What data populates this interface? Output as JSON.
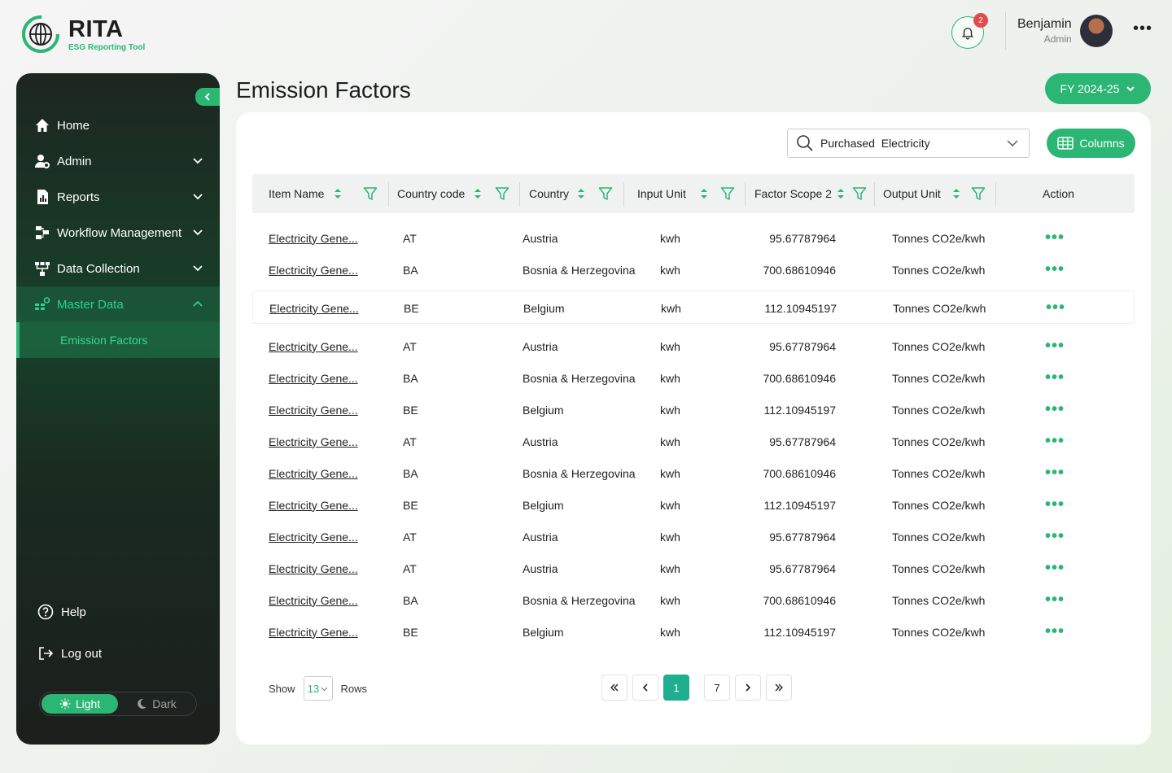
{
  "brand": {
    "title": "RITA",
    "subtitle": "ESG Reporting Tool"
  },
  "header": {
    "notifications": "2",
    "user_name": "Benjamin",
    "user_role": "Admin"
  },
  "sidebar": {
    "items": [
      {
        "label": "Home",
        "icon": "home-icon"
      },
      {
        "label": "Admin",
        "icon": "admin-icon"
      },
      {
        "label": "Reports",
        "icon": "reports-icon"
      },
      {
        "label": "Workflow Management",
        "icon": "workflow-icon"
      },
      {
        "label": "Data Collection",
        "icon": "data-collection-icon"
      },
      {
        "label": "Master Data",
        "icon": "master-data-icon"
      }
    ],
    "sub_item": "Emission Factors",
    "help": "Help",
    "logout": "Log out",
    "theme_light": "Light",
    "theme_dark": "Dark"
  },
  "page": {
    "title": "Emission Factors",
    "fy": "FY 2024-25"
  },
  "search": {
    "value": "Purchased  Electricity"
  },
  "columns_label": "Columns",
  "table": {
    "headers": [
      "Item Name",
      "Country code",
      "Country",
      "Input Unit",
      "Factor Scope 2",
      "Output Unit",
      "Action"
    ],
    "rows": [
      [
        "Electricity Gene...",
        "AT",
        "Austria",
        "kwh",
        "95.67787964",
        "Tonnes CO2e/kwh"
      ],
      [
        "Electricity Gene...",
        "BA",
        "Bosnia & Herzegovina",
        "kwh",
        "700.68610946",
        "Tonnes CO2e/kwh"
      ],
      [
        "Electricity Gene...",
        "BE",
        "Belgium",
        "kwh",
        "112.10945197",
        "Tonnes CO2e/kwh"
      ],
      [
        "Electricity Gene...",
        "AT",
        "Austria",
        "kwh",
        "95.67787964",
        "Tonnes CO2e/kwh"
      ],
      [
        "Electricity Gene...",
        "BA",
        "Bosnia & Herzegovina",
        "kwh",
        "700.68610946",
        "Tonnes CO2e/kwh"
      ],
      [
        "Electricity Gene...",
        "BE",
        "Belgium",
        "kwh",
        "112.10945197",
        "Tonnes CO2e/kwh"
      ],
      [
        "Electricity Gene...",
        "AT",
        "Austria",
        "kwh",
        "95.67787964",
        "Tonnes CO2e/kwh"
      ],
      [
        "Electricity Gene...",
        "BA",
        "Bosnia & Herzegovina",
        "kwh",
        "700.68610946",
        "Tonnes CO2e/kwh"
      ],
      [
        "Electricity Gene...",
        "BE",
        "Belgium",
        "kwh",
        "112.10945197",
        "Tonnes CO2e/kwh"
      ],
      [
        "Electricity Gene...",
        "AT",
        "Austria",
        "kwh",
        "95.67787964",
        "Tonnes CO2e/kwh"
      ],
      [
        "Electricity Gene...",
        "AT",
        "Austria",
        "kwh",
        "95.67787964",
        "Tonnes CO2e/kwh"
      ],
      [
        "Electricity Gene...",
        "BA",
        "Bosnia & Herzegovina",
        "kwh",
        "700.68610946",
        "Tonnes CO2e/kwh"
      ],
      [
        "Electricity Gene...",
        "BE",
        "Belgium",
        "kwh",
        "112.10945197",
        "Tonnes CO2e/kwh"
      ]
    ]
  },
  "footer": {
    "show": "Show",
    "rows_value": "13",
    "rows": "Rows",
    "current_page": "1",
    "last_page": "7"
  },
  "colors": {
    "accent": "#2bb673",
    "active_page": "#1fae8f",
    "badge": "#e5484d"
  }
}
